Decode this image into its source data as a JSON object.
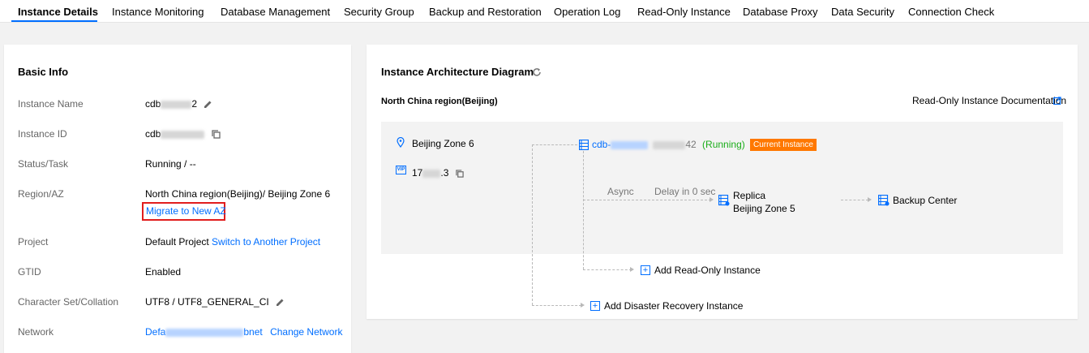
{
  "tabs": [
    {
      "label": "Instance Details",
      "active": true
    },
    {
      "label": "Instance Monitoring"
    },
    {
      "label": "Database Management"
    },
    {
      "label": "Security Group"
    },
    {
      "label": "Backup and Restoration"
    },
    {
      "label": "Operation Log"
    },
    {
      "label": "Read-Only Instance"
    },
    {
      "label": "Database Proxy"
    },
    {
      "label": "Data Security"
    },
    {
      "label": "Connection Check"
    }
  ],
  "basic": {
    "title": "Basic Info",
    "instance_name_label": "Instance Name",
    "instance_name_prefix": "cdb",
    "instance_name_suffix": "2",
    "instance_id_label": "Instance ID",
    "instance_id_prefix": "cdb",
    "status_label": "Status/Task",
    "status_value": "Running / --",
    "region_label": "Region/AZ",
    "region_value": "North China region(Beijing)/ Beijing Zone 6",
    "migrate_link": "Migrate to New AZ",
    "project_label": "Project",
    "project_value": "Default Project",
    "project_link": "Switch to Another Project",
    "gtid_label": "GTID",
    "gtid_value": "Enabled",
    "charset_label": "Character Set/Collation",
    "charset_value": "UTF8 / UTF8_GENERAL_CI",
    "network_label": "Network",
    "network_prefix": "Defa",
    "network_suffix": "bnet",
    "network_link": "Change Network"
  },
  "arch": {
    "title": "Instance Architecture Diagram",
    "region": "North China region(Beijing)",
    "doc_link": "Read-Only Instance Documentation",
    "zone": "Beijing Zone 6",
    "vip_badge": "VIP",
    "ip_prefix": "17",
    "ip_suffix": ".3",
    "instance_prefix": "cdb-",
    "instance_suffix": "42",
    "instance_status": "(Running)",
    "current_badge": "Current Instance",
    "async_label": "Async",
    "delay_label": "Delay in 0 sec",
    "replica_label": "Replica",
    "replica_zone": "Beijing Zone 5",
    "backup_label": "Backup Center",
    "add_readonly": "Add Read-Only Instance",
    "add_dr": "Add Disaster Recovery Instance"
  },
  "colors": {
    "link": "#006eff",
    "running": "#1aad19",
    "badge": "#ff7800",
    "highlight_border": "#e11d1d"
  }
}
